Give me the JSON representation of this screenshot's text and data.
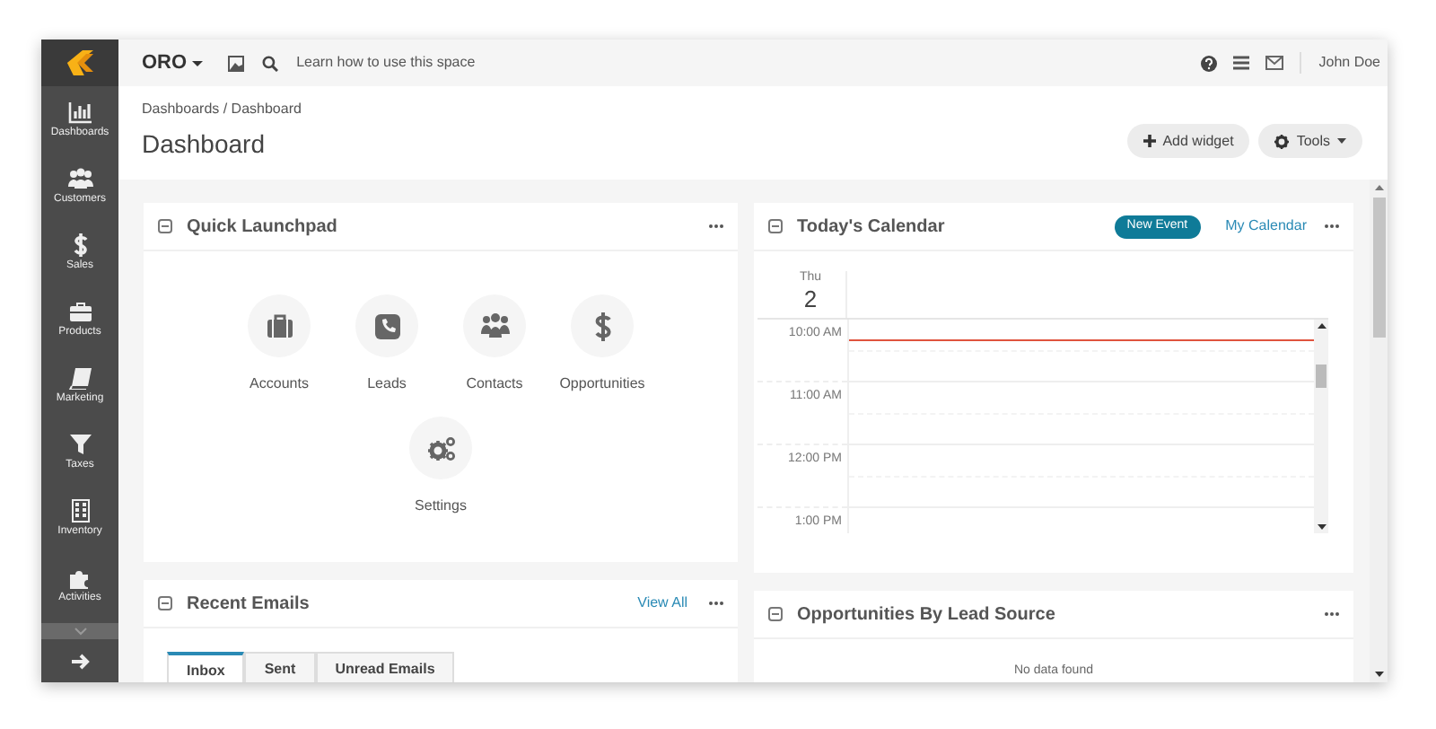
{
  "top_bar": {
    "brand": "ORO",
    "help_text": "Learn how to use this space",
    "user": "John Doe"
  },
  "sidebar": {
    "items": [
      {
        "label": "Dashboards"
      },
      {
        "label": "Customers"
      },
      {
        "label": "Sales"
      },
      {
        "label": "Products"
      },
      {
        "label": "Marketing"
      },
      {
        "label": "Taxes"
      },
      {
        "label": "Inventory"
      },
      {
        "label": "Activities"
      }
    ]
  },
  "header": {
    "breadcrumb": "Dashboards / Dashboard",
    "title": "Dashboard",
    "buttons": [
      "Add widget",
      "Tools"
    ]
  },
  "quick_launchpad": {
    "title": "Quick Launchpad",
    "items": [
      {
        "label": "Accounts"
      },
      {
        "label": "Leads"
      },
      {
        "label": "Contacts"
      },
      {
        "label": "Opportunities"
      },
      {
        "label": "Settings"
      }
    ]
  },
  "calendar": {
    "title": "Today's Calendar",
    "new_event": "New Event",
    "my_calendar": "My Calendar",
    "day_name": "Thu",
    "day_number": "2",
    "times": [
      "10:00 AM",
      "11:00 AM",
      "12:00 PM",
      "1:00 PM"
    ]
  },
  "recent_emails": {
    "title": "Recent Emails",
    "view_all": "View All",
    "tabs": [
      {
        "label": "Inbox",
        "selected": true
      },
      {
        "label": "Sent",
        "selected": false
      },
      {
        "label": "Unread Emails",
        "selected": false
      }
    ]
  },
  "opportunities_by_lead_source": {
    "title": "Opportunities By Lead Source",
    "empty_text": "No data found"
  }
}
